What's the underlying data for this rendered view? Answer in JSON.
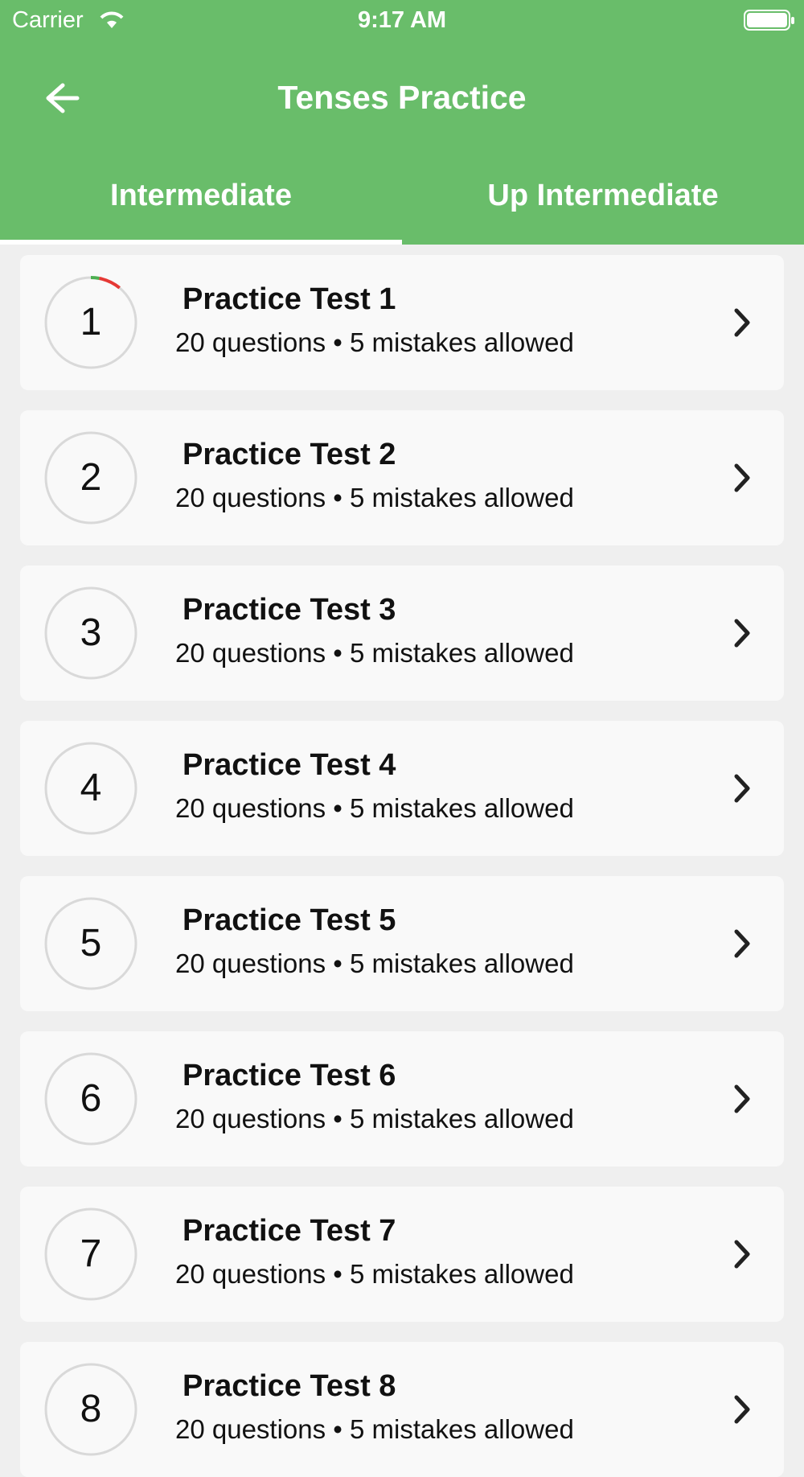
{
  "status_bar": {
    "carrier": "Carrier",
    "time": "9:17 AM"
  },
  "header": {
    "title": "Tenses Practice"
  },
  "tabs": [
    {
      "label": "Intermediate",
      "selected": true
    },
    {
      "label": "Up Intermediate",
      "selected": false
    }
  ],
  "tests": [
    {
      "number": "1",
      "title": "Practice Test 1",
      "subtitle": "20 questions • 5 mistakes allowed",
      "progress": {
        "correct": 0.03,
        "wrong": 0.08
      }
    },
    {
      "number": "2",
      "title": "Practice Test 2",
      "subtitle": "20 questions • 5 mistakes allowed",
      "progress": {
        "correct": 0,
        "wrong": 0
      }
    },
    {
      "number": "3",
      "title": "Practice Test 3",
      "subtitle": "20 questions • 5 mistakes allowed",
      "progress": {
        "correct": 0,
        "wrong": 0
      }
    },
    {
      "number": "4",
      "title": "Practice Test 4",
      "subtitle": "20 questions • 5 mistakes allowed",
      "progress": {
        "correct": 0,
        "wrong": 0
      }
    },
    {
      "number": "5",
      "title": "Practice Test 5",
      "subtitle": "20 questions • 5 mistakes allowed",
      "progress": {
        "correct": 0,
        "wrong": 0
      }
    },
    {
      "number": "6",
      "title": "Practice Test 6",
      "subtitle": "20 questions • 5 mistakes allowed",
      "progress": {
        "correct": 0,
        "wrong": 0
      }
    },
    {
      "number": "7",
      "title": "Practice Test 7",
      "subtitle": "20 questions • 5 mistakes allowed",
      "progress": {
        "correct": 0,
        "wrong": 0
      }
    },
    {
      "number": "8",
      "title": "Practice Test 8",
      "subtitle": "20 questions • 5 mistakes allowed",
      "progress": {
        "correct": 0,
        "wrong": 0
      }
    }
  ],
  "colors": {
    "header": "#69bd6a",
    "correct": "#4caf50",
    "wrong": "#e53935",
    "ring": "#d9d9d9"
  }
}
